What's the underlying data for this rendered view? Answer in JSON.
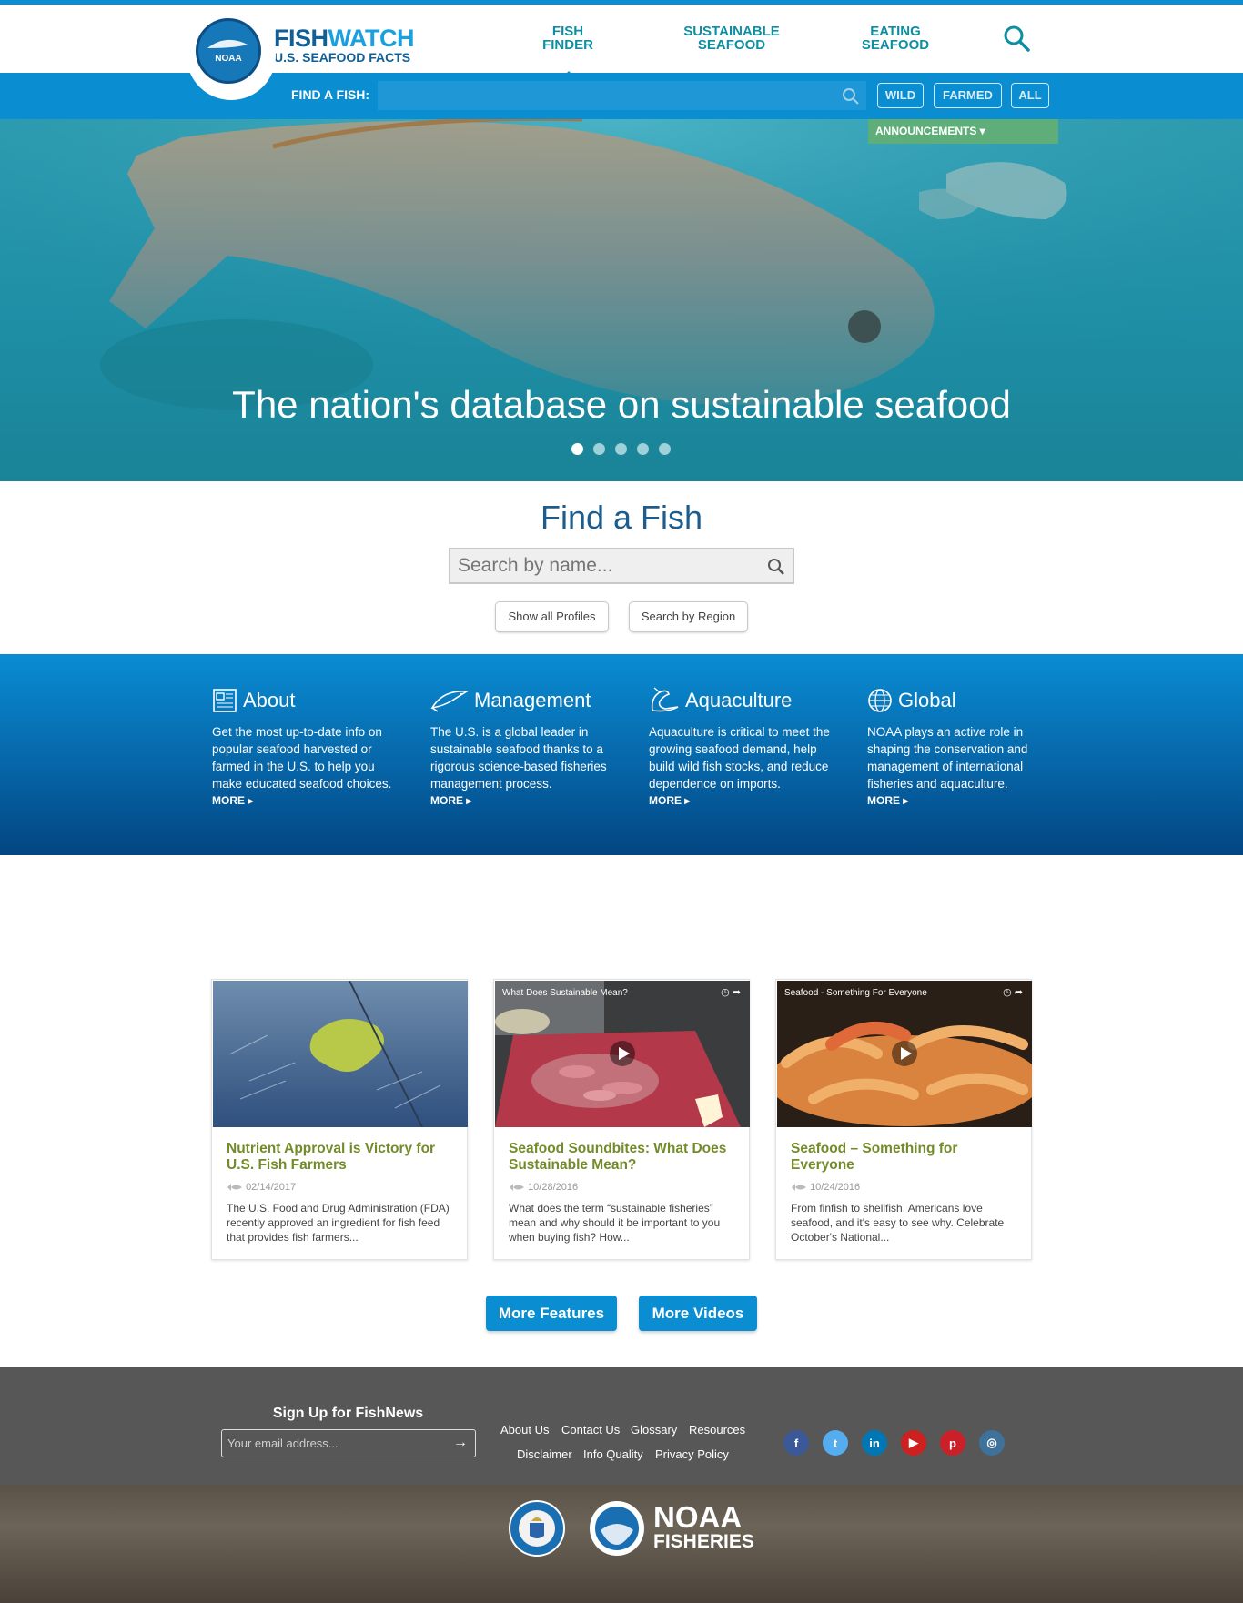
{
  "brand": {
    "title_a": "FISH",
    "title_b": "WATCH",
    "subtitle": "U.S. SEAFOOD FACTS",
    "logo_text": "NOAA"
  },
  "nav": [
    {
      "line1": "FISH",
      "line2": "FINDER"
    },
    {
      "line1": "SUSTAINABLE",
      "line2": "SEAFOOD"
    },
    {
      "line1": "EATING",
      "line2": "SEAFOOD"
    }
  ],
  "findbar": {
    "label": "FIND A FISH:",
    "placeholder": "",
    "filters": [
      "WILD",
      "FARMED",
      "ALL"
    ]
  },
  "announcements": "ANNOUNCEMENTS ▾",
  "hero": {
    "headline": "The nation's database on sustainable seafood",
    "slides": 5,
    "active_slide": 1
  },
  "find_fish": {
    "title": "Find a Fish",
    "placeholder": "Search by name...",
    "buttons": [
      "Show all Profiles",
      "Search by Region"
    ]
  },
  "info": [
    {
      "title": "About",
      "icon": "newspaper-icon",
      "text": "Get the most up-to-date info on popular seafood harvested or farmed in the U.S. to help you make educated seafood choices.",
      "more": "MORE ▸"
    },
    {
      "title": "Management",
      "icon": "fish-outline-icon",
      "text": "The U.S. is a global leader in sustainable seafood thanks to a rigorous science-based fisheries management process.",
      "more": "MORE ▸"
    },
    {
      "title": "Aquaculture",
      "icon": "shrimp-icon",
      "text": "Aquaculture is critical to meet the growing seafood demand, help build wild fish stocks, and reduce dependence on imports.",
      "more": "MORE ▸"
    },
    {
      "title": "Global",
      "icon": "globe-icon",
      "text": "NOAA plays an active role in shaping the conservation and management of international fisheries and aquaculture.",
      "more": "MORE ▸"
    }
  ],
  "cards": [
    {
      "video_title": "",
      "title": "Nutrient Approval is Victory for U.S. Fish Farmers",
      "date": "02/14/2017",
      "text": "The U.S. Food and Drug Administration (FDA) recently approved an ingredient for fish feed that provides fish farmers..."
    },
    {
      "video_title": "What Does Sustainable Mean?",
      "title": "Seafood Soundbites: What Does Sustainable Mean?",
      "date": "10/28/2016",
      "text": "What does the term “sustainable fisheries” mean and why should it be important to you when buying fish? How..."
    },
    {
      "video_title": "Seafood - Something For Everyone",
      "title": "Seafood – Something for Everyone",
      "date": "10/24/2016",
      "text": "From finfish to shellfish, Americans love seafood, and it's easy to see why. Celebrate October's National..."
    }
  ],
  "buttons": {
    "features": "More Features",
    "videos": "More Videos"
  },
  "footer": {
    "signup_title": "Sign Up for FishNews",
    "email_placeholder": "Your email address...",
    "links_row1": [
      "About Us",
      "Contact Us",
      "Glossary",
      "Resources"
    ],
    "links_row2": [
      "Disclaimer",
      "Info Quality",
      "Privacy Policy"
    ],
    "social": [
      {
        "icon": "facebook-icon",
        "glyph": "f",
        "color": "#3b5998"
      },
      {
        "icon": "twitter-icon",
        "glyph": "t",
        "color": "#55acee"
      },
      {
        "icon": "linkedin-icon",
        "glyph": "in",
        "color": "#0077b5"
      },
      {
        "icon": "youtube-icon",
        "glyph": "▶",
        "color": "#cd201f"
      },
      {
        "icon": "pinterest-icon",
        "glyph": "p",
        "color": "#cb2027"
      },
      {
        "icon": "instagram-icon",
        "glyph": "◎",
        "color": "#3f729b"
      }
    ]
  },
  "bottom": {
    "noaa_line1": "NOAA",
    "noaa_line2": "FISHERIES"
  }
}
